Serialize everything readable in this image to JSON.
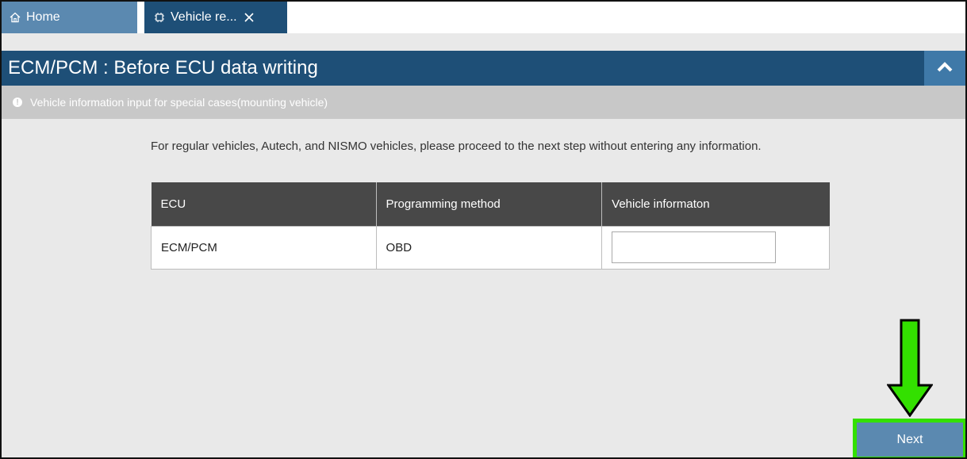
{
  "tabs": {
    "home_label": "Home",
    "vehicle_label": "Vehicle re...",
    "home_icon": "home-icon",
    "vehicle_icon": "ecu-chip-icon",
    "close_icon": "close-icon"
  },
  "header": {
    "title": "ECM/PCM : Before ECU data writing",
    "collapse_icon": "chevron-up-icon"
  },
  "infobar": {
    "text": "Vehicle information input for special cases(mounting vehicle)",
    "icon": "info-icon"
  },
  "instruction": "For regular vehicles, Autech, and NISMO vehicles, please proceed to the next step without entering any information.",
  "table": {
    "headers": [
      "ECU",
      "Programming method",
      "Vehicle informaton"
    ],
    "rows": [
      {
        "ecu": "ECM/PCM",
        "method": "OBD",
        "vehicle_info": ""
      }
    ]
  },
  "next_label": "Next",
  "colors": {
    "header_bg": "#1e4f77",
    "tab_home_bg": "#5b89b0",
    "button_bg": "#5b89b0",
    "highlight_green": "#33e000",
    "table_header_bg": "#484848"
  }
}
